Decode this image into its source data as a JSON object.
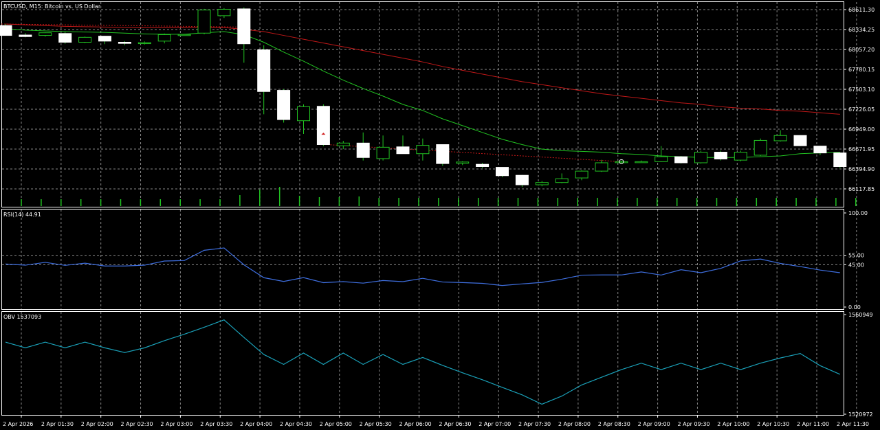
{
  "main": {
    "title": "BTCUSD, M15:  Bitcoin vs. US Dollar",
    "price_labels": [
      "68611.30",
      "68334.25",
      "68057.20",
      "67780.15",
      "67503.10",
      "67226.05",
      "66949.00",
      "66671.95",
      "66394.90",
      "66117.85"
    ],
    "price_range": [
      65980,
      68680
    ],
    "colors": {
      "ma_fast": "#22c322",
      "ma_slow": "#c01818",
      "bull_body": "#000000",
      "bear_body": "#ffffff",
      "wick": "#22c322",
      "volume": "#22c322",
      "grid": "#8a8a8a"
    }
  },
  "chart_data": [
    {
      "type": "candlestick",
      "title": "BTCUSD, M15:  Bitcoin vs. US Dollar",
      "candles": [
        {
          "o": 68370,
          "h": 68390,
          "l": 68235,
          "c": 68240
        },
        {
          "o": 68245,
          "h": 68270,
          "l": 68215,
          "c": 68225
        },
        {
          "o": 68240,
          "h": 68280,
          "l": 68225,
          "c": 68275
        },
        {
          "o": 68265,
          "h": 68290,
          "l": 68130,
          "c": 68150
        },
        {
          "o": 68150,
          "h": 68225,
          "l": 68140,
          "c": 68215
        },
        {
          "o": 68230,
          "h": 68235,
          "l": 68125,
          "c": 68165
        },
        {
          "o": 68150,
          "h": 68165,
          "l": 68110,
          "c": 68135
        },
        {
          "o": 68138,
          "h": 68160,
          "l": 68120,
          "c": 68145
        },
        {
          "o": 68165,
          "h": 68265,
          "l": 68135,
          "c": 68250
        },
        {
          "o": 68245,
          "h": 68260,
          "l": 68238,
          "c": 68252
        },
        {
          "o": 68270,
          "h": 68590,
          "l": 68255,
          "c": 68575
        },
        {
          "o": 68500,
          "h": 68600,
          "l": 68470,
          "c": 68585
        },
        {
          "o": 68590,
          "h": 68610,
          "l": 67880,
          "c": 68130
        },
        {
          "o": 68050,
          "h": 68110,
          "l": 67200,
          "c": 67500
        },
        {
          "o": 67515,
          "h": 67530,
          "l": 67090,
          "c": 67130
        },
        {
          "o": 67115,
          "h": 67330,
          "l": 66940,
          "c": 67300
        },
        {
          "o": 67305,
          "h": 67330,
          "l": 66780,
          "c": 66800
        },
        {
          "o": 66785,
          "h": 66850,
          "l": 66740,
          "c": 66820
        },
        {
          "o": 66820,
          "h": 66960,
          "l": 66590,
          "c": 66630
        },
        {
          "o": 66615,
          "h": 66920,
          "l": 66590,
          "c": 66765
        },
        {
          "o": 66770,
          "h": 66920,
          "l": 66680,
          "c": 66680
        },
        {
          "o": 66680,
          "h": 66880,
          "l": 66590,
          "c": 66790
        },
        {
          "o": 66800,
          "h": 66800,
          "l": 66520,
          "c": 66550
        },
        {
          "o": 66555,
          "h": 66580,
          "l": 66530,
          "c": 66570
        },
        {
          "o": 66540,
          "h": 66560,
          "l": 66490,
          "c": 66510
        },
        {
          "o": 66500,
          "h": 66500,
          "l": 66370,
          "c": 66390
        },
        {
          "o": 66395,
          "h": 66400,
          "l": 66240,
          "c": 66270
        },
        {
          "o": 66270,
          "h": 66320,
          "l": 66250,
          "c": 66300
        },
        {
          "o": 66300,
          "h": 66420,
          "l": 66290,
          "c": 66350
        },
        {
          "o": 66360,
          "h": 66460,
          "l": 66330,
          "c": 66450
        },
        {
          "o": 66450,
          "h": 66600,
          "l": 66440,
          "c": 66560
        },
        {
          "o": 66570,
          "h": 66590,
          "l": 66560,
          "c": 66575
        },
        {
          "o": 66570,
          "h": 66590,
          "l": 66560,
          "c": 66575
        },
        {
          "o": 66575,
          "h": 66780,
          "l": 66570,
          "c": 66640
        },
        {
          "o": 66640,
          "h": 66650,
          "l": 66550,
          "c": 66560
        },
        {
          "o": 66560,
          "h": 66720,
          "l": 66550,
          "c": 66700
        },
        {
          "o": 66700,
          "h": 66720,
          "l": 66590,
          "c": 66610
        },
        {
          "o": 66595,
          "h": 66720,
          "l": 66580,
          "c": 66700
        },
        {
          "o": 66660,
          "h": 66880,
          "l": 66650,
          "c": 66855
        },
        {
          "o": 66850,
          "h": 66990,
          "l": 66840,
          "c": 66920
        },
        {
          "o": 66920,
          "h": 66925,
          "l": 66780,
          "c": 66785
        },
        {
          "o": 66780,
          "h": 66785,
          "l": 66660,
          "c": 66690
        },
        {
          "o": 66690,
          "h": 66700,
          "l": 66490,
          "c": 66510
        }
      ],
      "ma_fast": [
        68330,
        68310,
        68300,
        68290,
        68285,
        68280,
        68270,
        68260,
        68255,
        68255,
        68275,
        68290,
        68250,
        68150,
        68020,
        67900,
        67770,
        67650,
        67540,
        67440,
        67330,
        67250,
        67140,
        67050,
        66960,
        66870,
        66800,
        66740,
        66720,
        66710,
        66700,
        66680,
        66670,
        66650,
        66640,
        66630,
        66630,
        66630,
        66640,
        66650,
        66680,
        66690,
        66700
      ],
      "ma_slow": [
        68390,
        68380,
        68370,
        68360,
        68355,
        68350,
        68345,
        68340,
        68340,
        68340,
        68345,
        68345,
        68320,
        68290,
        68240,
        68190,
        68140,
        68090,
        68040,
        67990,
        67940,
        67890,
        67830,
        67780,
        67730,
        67680,
        67630,
        67590,
        67550,
        67510,
        67470,
        67440,
        67410,
        67380,
        67350,
        67330,
        67300,
        67280,
        67270,
        67250,
        67240,
        67220,
        67200
      ],
      "volume": [
        10,
        10,
        10,
        10,
        10,
        10,
        10,
        10,
        10,
        10,
        10,
        16,
        24,
        28,
        15,
        13,
        13,
        14,
        12,
        12,
        12,
        12,
        12,
        12,
        12,
        12,
        12,
        12,
        12,
        12,
        12,
        12,
        12,
        12,
        12,
        12,
        12,
        12,
        12,
        12,
        12,
        12,
        12
      ]
    },
    {
      "type": "line",
      "title": "RSI(14) 44.91",
      "ylim": [
        0,
        100
      ],
      "tick_labels": [
        "100.00",
        "55.00",
        "45.00",
        "0.00"
      ],
      "levels": [
        55,
        45
      ],
      "series": [
        {
          "values": [
            45.7,
            44.5,
            47.5,
            44.3,
            46.6,
            43.6,
            43.6,
            44.5,
            48.9,
            49.4,
            60.3,
            62.8,
            44.9,
            31.2,
            27.2,
            31.3,
            25.9,
            27.0,
            25.4,
            28.2,
            27.0,
            30.5,
            26.6,
            26.0,
            25.2,
            22.9,
            24.6,
            26.2,
            29.6,
            33.9,
            34.1,
            34.1,
            37.3,
            34.0,
            39.7,
            36.5,
            41.1,
            49.1,
            51.0,
            46.4,
            43.0,
            39.3,
            36.5
          ]
        }
      ]
    },
    {
      "type": "line",
      "title": "OBV 1537093",
      "tick_labels": [
        "1560949",
        "1520972"
      ],
      "ylim": [
        1520972,
        1560949
      ],
      "series": [
        {
          "values": [
            1550100,
            1547800,
            1550100,
            1547800,
            1550100,
            1547800,
            1545900,
            1547800,
            1550700,
            1553300,
            1556100,
            1559100,
            1552000,
            1545100,
            1541100,
            1545700,
            1541100,
            1545700,
            1541100,
            1545100,
            1541100,
            1543900,
            1540700,
            1537700,
            1534900,
            1531800,
            1528800,
            1525000,
            1528300,
            1532800,
            1535900,
            1539000,
            1541600,
            1539000,
            1541600,
            1539000,
            1541600,
            1539000,
            1541600,
            1543700,
            1545500,
            1540600,
            1537093
          ]
        }
      ]
    }
  ],
  "time_labels": [
    "2 Apr 2026",
    "2 Apr 01:30",
    "2 Apr 02:00",
    "2 Apr 02:30",
    "2 Apr 03:00",
    "2 Apr 03:30",
    "2 Apr 04:00",
    "2 Apr 04:30",
    "2 Apr 05:00",
    "2 Apr 05:30",
    "2 Apr 06:00",
    "2 Apr 06:30",
    "2 Apr 07:00",
    "2 Apr 07:30",
    "2 Apr 08:00",
    "2 Apr 08:30",
    "2 Apr 09:00",
    "2 Apr 09:30",
    "2 Apr 10:00",
    "2 Apr 10:30",
    "2 Apr 11:00",
    "2 Apr 11:30"
  ]
}
